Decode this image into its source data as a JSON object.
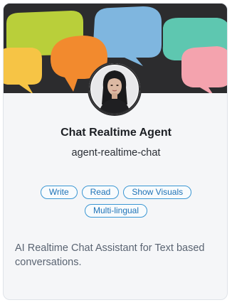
{
  "agent": {
    "title": "Chat Realtime Agent",
    "slug": "agent-realtime-chat",
    "tags": [
      "Write",
      "Read",
      "Show Visuals",
      "Multi-lingual"
    ],
    "description": "AI Realtime Chat Assistant for Text based conversations."
  },
  "colors": {
    "tag_border": "#3b97d3",
    "tag_text": "#1f73b7",
    "banner_background": "#2c2c2e",
    "bubble_lime": "#b9cf3a",
    "bubble_blue": "#7fb6df",
    "bubble_teal": "#5ec7b0",
    "bubble_orange": "#f28a2e",
    "bubble_yellow": "#f6c445",
    "bubble_pink": "#f4a3ae"
  },
  "icons": {
    "banner": "speech-bubbles-illustration",
    "avatar": "agent-portrait"
  }
}
